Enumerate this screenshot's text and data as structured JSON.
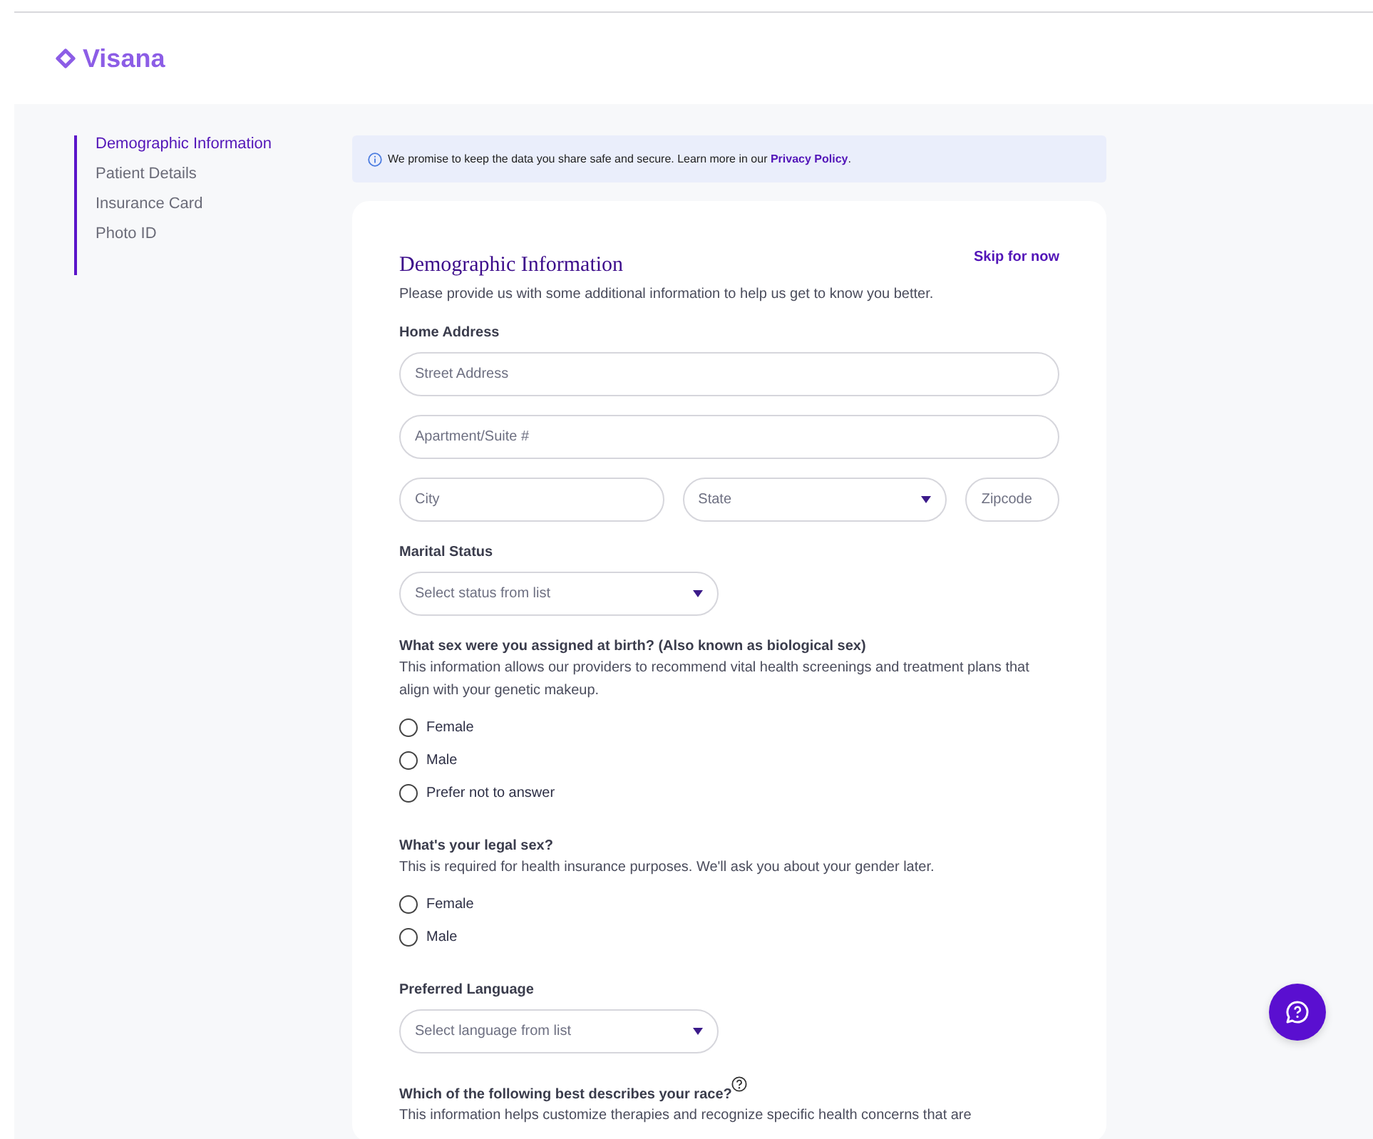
{
  "logo": {
    "name": "Visana"
  },
  "sidebar": {
    "items": [
      {
        "label": "Demographic Information",
        "selected": true
      },
      {
        "label": "Patient Details",
        "selected": false
      },
      {
        "label": "Insurance Card",
        "selected": false
      },
      {
        "label": "Photo ID",
        "selected": false
      }
    ]
  },
  "notice": {
    "text": "We promise to keep the data you share safe and secure. Learn more in our ",
    "link": "Privacy Policy",
    "end": "."
  },
  "form": {
    "title": "Demographic Information",
    "skip": "Skip for now",
    "subtitle": "Please provide us with some additional information to help us get to know you better.",
    "sections": [
      {
        "kind": "fields",
        "label": "Home Address",
        "rows": [
          [
            {
              "kind": "text",
              "placeholder": "Street Address"
            }
          ],
          [
            {
              "kind": "text",
              "placeholder": "Apartment/Suite #"
            }
          ],
          [
            {
              "kind": "text",
              "placeholder": "City"
            },
            {
              "kind": "select",
              "placeholder": "State"
            },
            {
              "kind": "text",
              "placeholder": "Zipcode"
            }
          ]
        ]
      },
      {
        "kind": "fields",
        "label": "Marital Status",
        "rows": [
          [
            {
              "kind": "select",
              "placeholder": "Select status from list"
            }
          ]
        ]
      },
      {
        "kind": "radios",
        "label": "What sex were you assigned at birth? (Also known as biological sex)",
        "help": "This information allows our providers to recommend vital health screenings and treatment plans that align with your genetic makeup.",
        "options": [
          {
            "label": "Female",
            "selected": false
          },
          {
            "label": "Male",
            "selected": false
          },
          {
            "label": "Prefer not to answer",
            "selected": false
          }
        ]
      },
      {
        "kind": "radios",
        "label": "What's your legal sex?",
        "help": "This is required for health insurance purposes. We'll ask you about your gender later.",
        "options": [
          {
            "label": "Female",
            "selected": false
          },
          {
            "label": "Male",
            "selected": false
          }
        ]
      },
      {
        "kind": "fields",
        "label": "Preferred Language",
        "rows": [
          [
            {
              "kind": "select",
              "placeholder": "Select language from list"
            }
          ]
        ]
      },
      {
        "kind": "radios",
        "label": "Which of the following best describes your race?",
        "info": true,
        "help": "This information helps customize therapies and recognize specific health concerns that are"
      }
    ]
  }
}
